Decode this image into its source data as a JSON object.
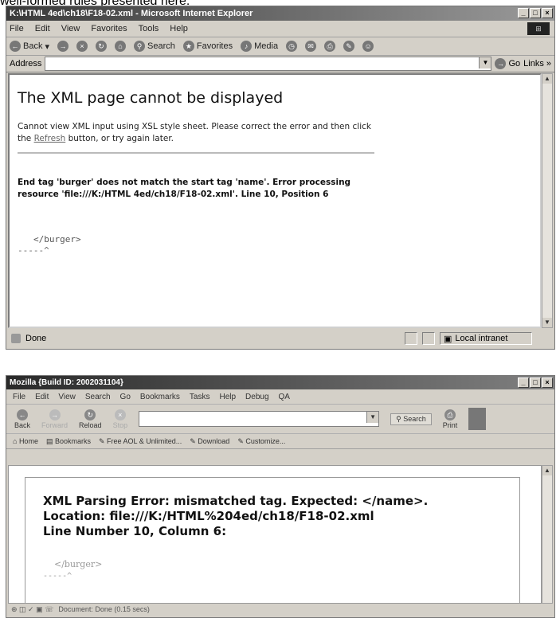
{
  "caption": "well-formed rules presented here.",
  "ie": {
    "title": "K:\\HTML 4ed\\ch18\\F18-02.xml - Microsoft Internet Explorer",
    "menu": [
      "File",
      "Edit",
      "View",
      "Favorites",
      "Tools",
      "Help"
    ],
    "toolbar": {
      "back": "Back",
      "search": "Search",
      "favorites": "Favorites",
      "media": "Media"
    },
    "address_label": "Address",
    "address_value": "",
    "go": "Go",
    "links": "Links »",
    "heading": "The XML page cannot be displayed",
    "message_pre": "Cannot view XML input using XSL style sheet. Please correct the error and then click the ",
    "refresh_link": "Refresh",
    "message_post": " button, or try again later.",
    "error_text": "End tag 'burger' does not match the start tag 'name'. Error processing resource 'file:///K:/HTML 4ed/ch18/F18-02.xml'. Line 10, Position 6",
    "code_line": "</burger>",
    "caret_line": "-----^",
    "status": "Done",
    "zone": "Local intranet"
  },
  "moz": {
    "title": "Mozilla {Build ID: 2002031104}",
    "menu": [
      "File",
      "Edit",
      "View",
      "Search",
      "Go",
      "Bookmarks",
      "Tasks",
      "Help",
      "Debug",
      "QA"
    ],
    "nav": {
      "back": "Back",
      "forward": "Forward",
      "reload": "Reload",
      "stop": "Stop",
      "search": "Search",
      "print": "Print"
    },
    "bookmarks_bar": [
      "Home",
      "Bookmarks",
      "Free AOL & Unlimited...",
      "Download",
      "Customize..."
    ],
    "error_lines": [
      "XML Parsing Error: mismatched tag. Expected: </name>.",
      "Location: file:///K:/HTML%204ed/ch18/F18-02.xml",
      "Line Number 10, Column 6:"
    ],
    "code_line": "</burger>",
    "caret_line": "-----^",
    "status": "Document: Done (0.15 secs)"
  }
}
